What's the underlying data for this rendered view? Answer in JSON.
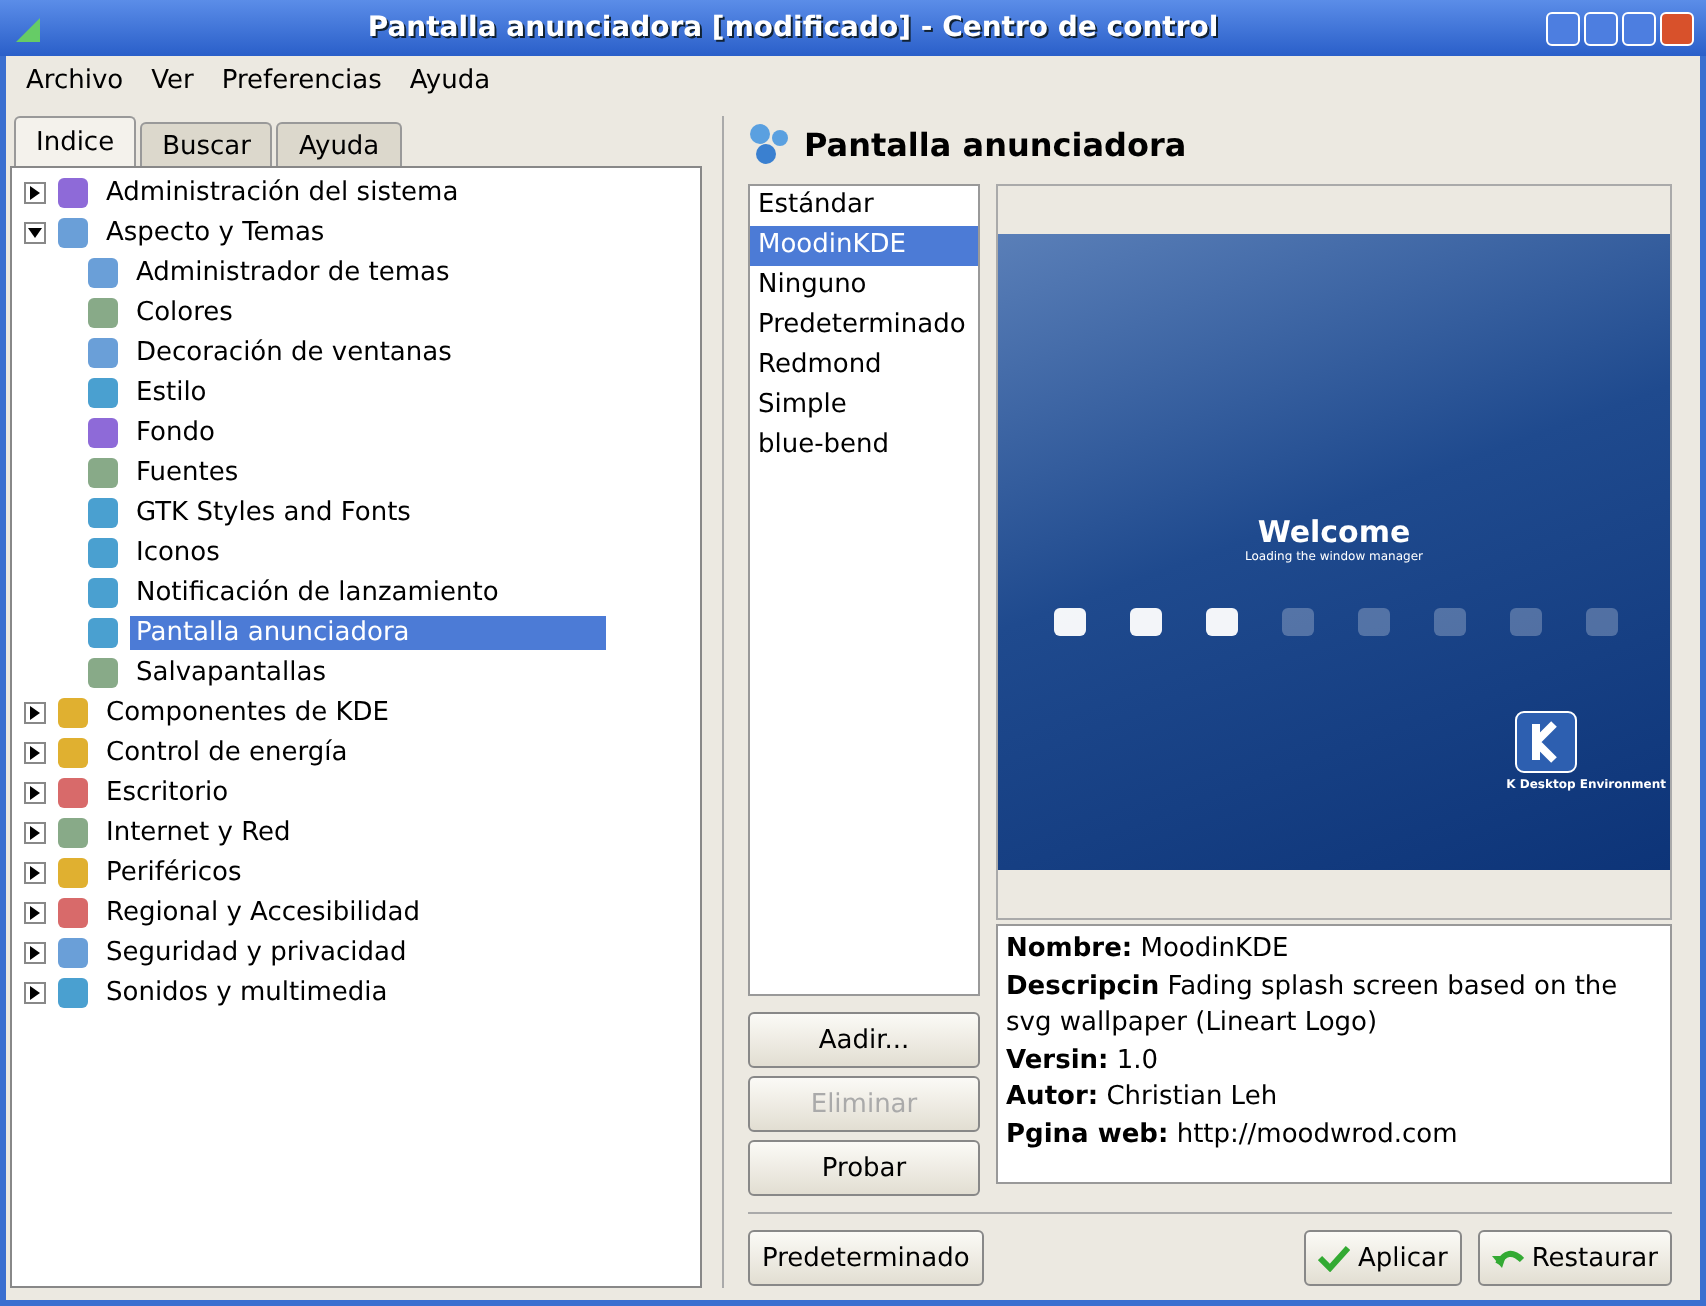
{
  "window": {
    "title": "Pantalla anunciadora [modificado] - Centro de control"
  },
  "menu": [
    "Archivo",
    "Ver",
    "Preferencias",
    "Ayuda"
  ],
  "tabs": [
    {
      "label": "Indice",
      "selected": true
    },
    {
      "label": "Buscar",
      "selected": false
    },
    {
      "label": "Ayuda",
      "selected": false
    }
  ],
  "tree": [
    {
      "label": "Administración del sistema",
      "expanded": false,
      "selected": false
    },
    {
      "label": "Aspecto y Temas",
      "expanded": true,
      "selected": false,
      "children": [
        {
          "label": "Administrador de temas",
          "selected": false
        },
        {
          "label": "Colores",
          "selected": false
        },
        {
          "label": "Decoración de ventanas",
          "selected": false
        },
        {
          "label": "Estilo",
          "selected": false
        },
        {
          "label": "Fondo",
          "selected": false
        },
        {
          "label": "Fuentes",
          "selected": false
        },
        {
          "label": "GTK Styles and Fonts",
          "selected": false
        },
        {
          "label": "Iconos",
          "selected": false
        },
        {
          "label": "Notificación de lanzamiento",
          "selected": false
        },
        {
          "label": "Pantalla anunciadora",
          "selected": true
        },
        {
          "label": "Salvapantallas",
          "selected": false
        }
      ]
    },
    {
      "label": "Componentes de KDE",
      "expanded": false,
      "selected": false
    },
    {
      "label": "Control de energía",
      "expanded": false,
      "selected": false
    },
    {
      "label": "Escritorio",
      "expanded": false,
      "selected": false
    },
    {
      "label": "Internet y Red",
      "expanded": false,
      "selected": false
    },
    {
      "label": "Periféricos",
      "expanded": false,
      "selected": false
    },
    {
      "label": "Regional y Accesibilidad",
      "expanded": false,
      "selected": false
    },
    {
      "label": "Seguridad y privacidad",
      "expanded": false,
      "selected": false
    },
    {
      "label": "Sonidos y multimedia",
      "expanded": false,
      "selected": false
    }
  ],
  "module": {
    "title": "Pantalla anunciadora"
  },
  "themes": [
    {
      "label": "Estándar",
      "selected": false
    },
    {
      "label": "MoodinKDE",
      "selected": true
    },
    {
      "label": "Ninguno",
      "selected": false
    },
    {
      "label": "Predeterminado",
      "selected": false
    },
    {
      "label": "Redmond",
      "selected": false
    },
    {
      "label": "Simple",
      "selected": false
    },
    {
      "label": "blue-bend",
      "selected": false
    }
  ],
  "theme_buttons": [
    {
      "label": "Aadir...",
      "disabled": false
    },
    {
      "label": "Eliminar",
      "disabled": true
    },
    {
      "label": "Probar",
      "disabled": false
    }
  ],
  "preview": {
    "heading": "Welcome",
    "subheading": "Loading the window manager",
    "footer": "K Desktop Environment"
  },
  "info": [
    {
      "key": "Nombre:",
      "value": "MoodinKDE"
    },
    {
      "key": "Descripcin",
      "value": "Fading splash screen based on the svg wallpaper (Lineart Logo)"
    },
    {
      "key": "Versin:",
      "value": "1.0"
    },
    {
      "key": "Autor:",
      "value": "Christian Leh"
    },
    {
      "key": "Pgina web:",
      "value": "http://moodwrod.com"
    }
  ],
  "bottom_buttons": [
    {
      "label": "Predeterminado",
      "kind": "plain"
    },
    {
      "label": "Aplicar",
      "kind": "apply"
    },
    {
      "label": "Restaurar",
      "kind": "reset"
    }
  ]
}
